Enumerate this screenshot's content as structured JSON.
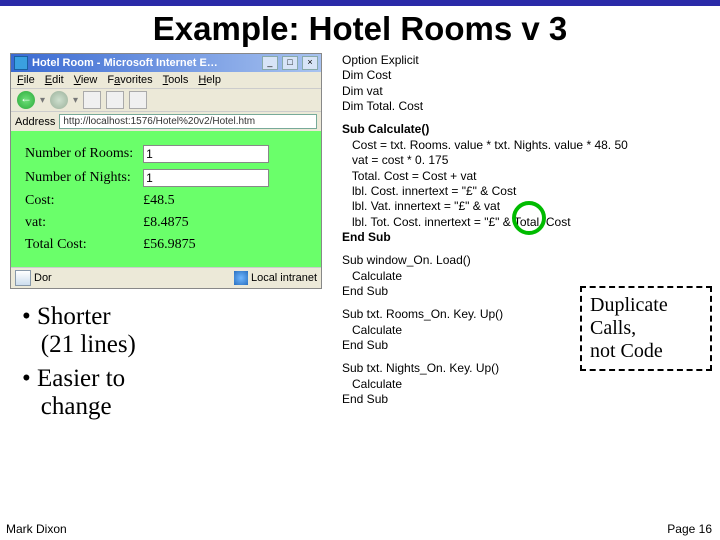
{
  "slide": {
    "title": "Example: Hotel Rooms v 3",
    "footer_left": "Mark Dixon",
    "footer_right": "Page 16"
  },
  "browser": {
    "title": "Hotel Room - Microsoft Internet E…",
    "menu": {
      "file": "File",
      "edit": "Edit",
      "view": "View",
      "favorites": "Favorites",
      "tools": "Tools",
      "help": "Help"
    },
    "toolbar_sep": "▾",
    "address_label": "Address",
    "url": "http://localhost:1576/Hotel%20v2/Hotel.htm",
    "status_done": "Dor",
    "status_zone": "Local intranet"
  },
  "form": {
    "rooms_label": "Number of Rooms:",
    "rooms_value": "1",
    "nights_label": "Number of Nights:",
    "nights_value": "1",
    "cost_label": "Cost:",
    "cost_value": "£48.5",
    "vat_label": "vat:",
    "vat_value": "£8.4875",
    "total_label": "Total Cost:",
    "total_value": "£56.9875"
  },
  "bullets": {
    "b1a": "Shorter",
    "b1b": "(21 lines)",
    "b2a": "Easier to",
    "b2b": "change"
  },
  "code": {
    "decl1": "Option Explicit",
    "decl2": "Dim Cost",
    "decl3": "Dim vat",
    "decl4": "Dim Total. Cost",
    "calc_head": "Sub Calculate()",
    "calc1": "Cost = txt. Rooms. value * txt. Nights. value * 48. 50",
    "calc2": "vat = cost * 0. 175",
    "calc3": "Total. Cost = Cost + vat",
    "calc4": "lbl. Cost. innertext = \"£\" & Cost",
    "calc5": "lbl. Vat. innertext = \"£\" & vat",
    "calc6": "lbl. Tot. Cost. innertext = \"£\" & Total. Cost",
    "calc_end": "End Sub",
    "onload_head": "Sub window_On. Load()",
    "onload_body": "Calculate",
    "onload_end": "End Sub",
    "rooms_head": "Sub txt. Rooms_On. Key. Up()",
    "rooms_body": "Calculate",
    "rooms_end": "End Sub",
    "nights_head": "Sub txt. Nights_On. Key. Up()",
    "nights_body": "Calculate",
    "nights_end": "End Sub"
  },
  "callout": {
    "l1": "Duplicate",
    "l2": "Calls,",
    "l3": "not Code"
  }
}
